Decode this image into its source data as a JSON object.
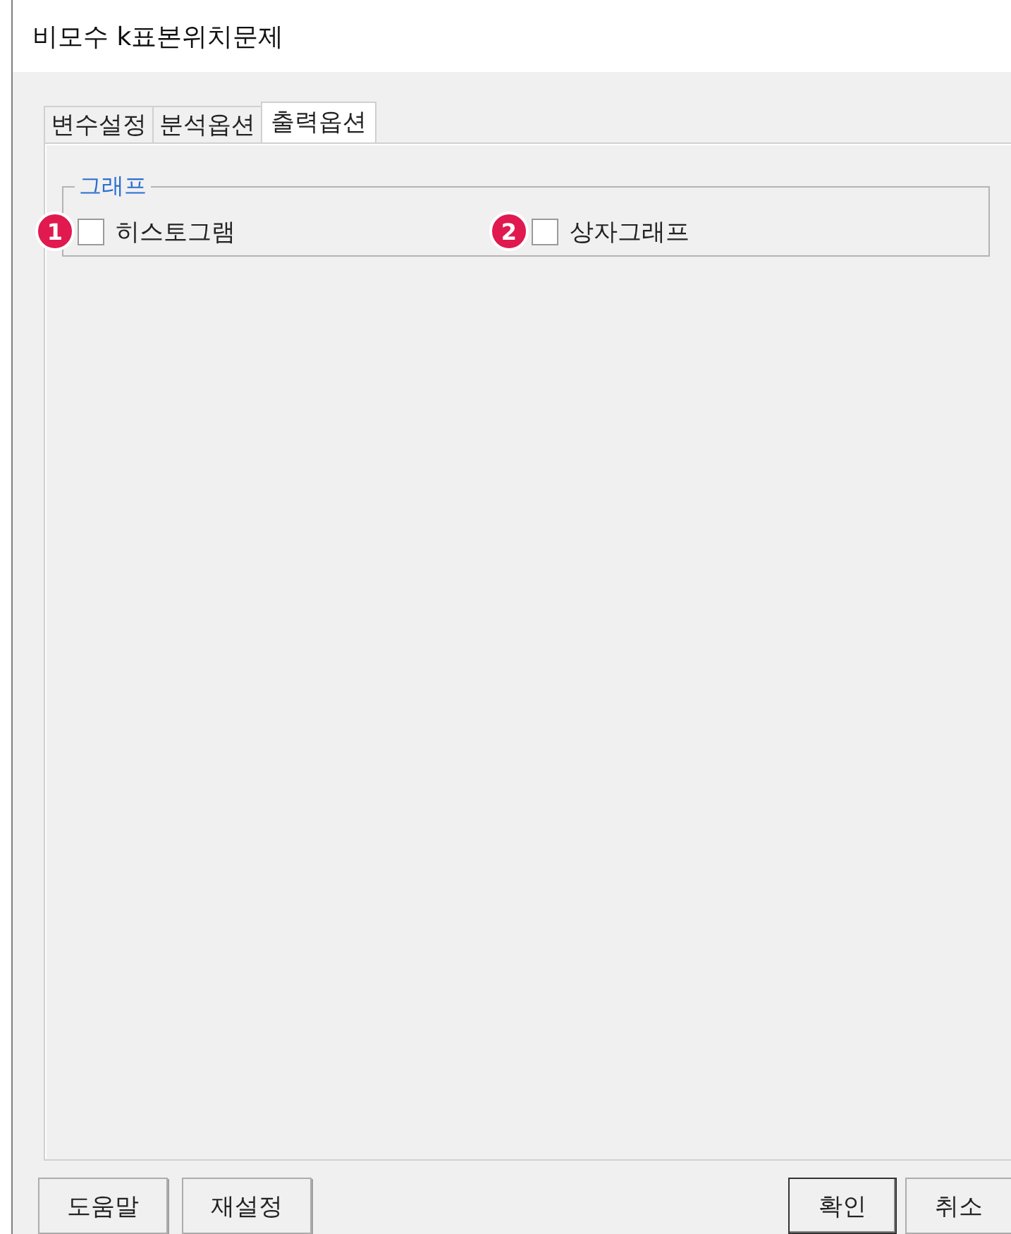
{
  "window": {
    "title": "비모수 k표본위치문제"
  },
  "tabs": [
    {
      "label": "변수설정",
      "selected": false
    },
    {
      "label": "분석옵션",
      "selected": false
    },
    {
      "label": "출력옵션",
      "selected": true
    }
  ],
  "group": {
    "title": "그래프",
    "options": [
      {
        "marker": "1",
        "label": "히스토그램",
        "checked": false
      },
      {
        "marker": "2",
        "label": "상자그래프",
        "checked": false
      }
    ]
  },
  "buttons": [
    {
      "label": "도움말",
      "default": false
    },
    {
      "label": "재설정",
      "default": false
    },
    {
      "label": "확인",
      "default": true
    },
    {
      "label": "취소",
      "default": false
    }
  ]
}
